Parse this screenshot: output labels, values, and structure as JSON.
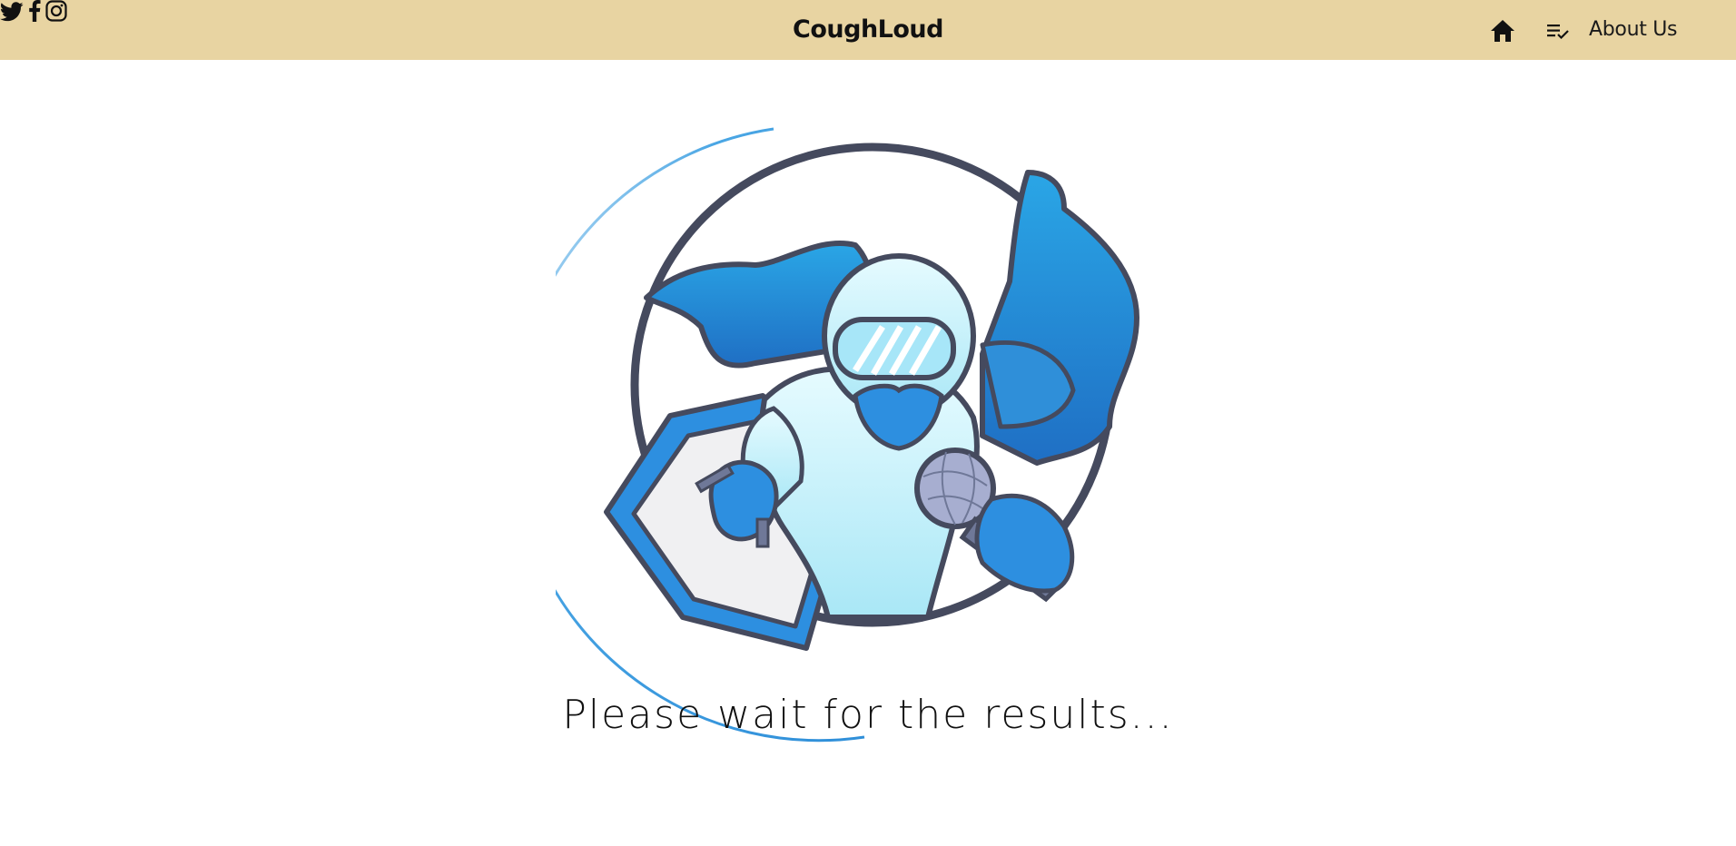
{
  "app": {
    "brand": "CoughLoud"
  },
  "nav": {
    "social": [
      {
        "name": "twitter-icon"
      },
      {
        "name": "facebook-icon"
      },
      {
        "name": "instagram-icon"
      }
    ],
    "about_label": "About Us"
  },
  "main": {
    "status_text": "Please wait for the results..."
  },
  "colors": {
    "navbar_bg": "#e8d4a2",
    "spinner": "#2f8fd9",
    "ring": "#454a5e",
    "suit": "#c9f3fb",
    "cape": "#2a8fd9"
  }
}
